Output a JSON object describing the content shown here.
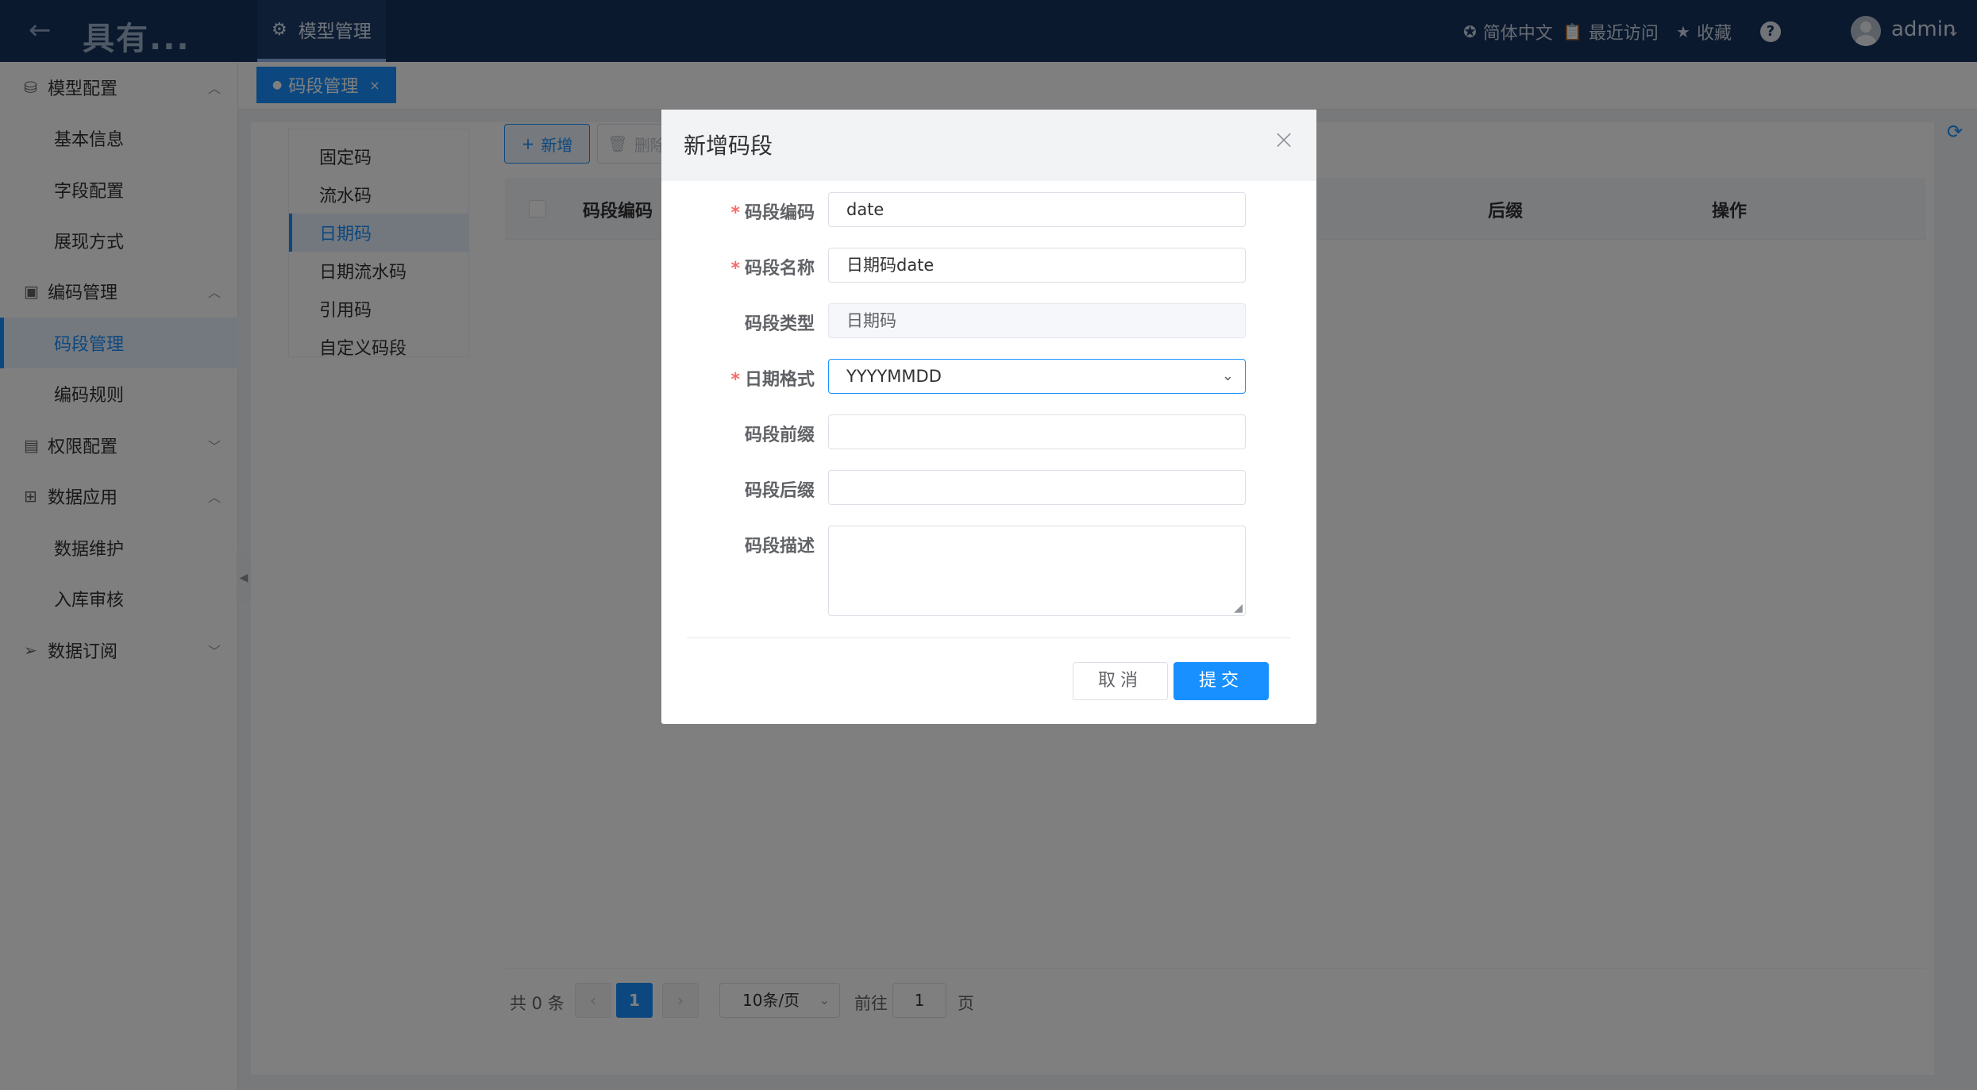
{
  "header": {
    "title": "具有...",
    "active_module": "模型管理",
    "language": "简体中文",
    "recent": "最近访问",
    "favorites": "收藏",
    "help": "?",
    "user": "admin"
  },
  "sidebar": {
    "groups": [
      {
        "label": "模型配置",
        "items": [
          "基本信息",
          "字段配置",
          "展现方式"
        ]
      },
      {
        "label": "编码管理",
        "items": [
          "码段管理",
          "编码规则"
        ]
      },
      {
        "label": "权限配置",
        "items": []
      },
      {
        "label": "数据应用",
        "items": [
          "数据维护",
          "入库审核"
        ]
      },
      {
        "label": "数据订阅",
        "items": []
      }
    ],
    "active_item": "码段管理"
  },
  "page_tab": {
    "label": "码段管理",
    "close": "×"
  },
  "segment_types": [
    "固定码",
    "流水码",
    "日期码",
    "日期流水码",
    "引用码",
    "自定义码段"
  ],
  "segment_types_active": "日期码",
  "toolbar": {
    "add": "新增",
    "delete": "删除"
  },
  "table": {
    "columns": [
      "码段编码",
      "后缀",
      "操作"
    ]
  },
  "pagination": {
    "total": "共 0 条",
    "current_page": "1",
    "page_size": "10条/页",
    "goto_label": "前往",
    "goto_value": "1",
    "page_suffix": "页"
  },
  "dialog": {
    "title": "新增码段",
    "fields": [
      {
        "label": "码段编码",
        "required": true,
        "value": "date"
      },
      {
        "label": "码段名称",
        "required": true,
        "value": "日期码date"
      },
      {
        "label": "码段类型",
        "required": false,
        "value": "日期码",
        "disabled": true
      },
      {
        "label": "日期格式",
        "required": true,
        "value": "YYYYMMDD",
        "type": "select"
      },
      {
        "label": "码段前缀",
        "required": false,
        "value": ""
      },
      {
        "label": "码段后缀",
        "required": false,
        "value": ""
      },
      {
        "label": "码段描述",
        "required": false,
        "value": "",
        "type": "textarea"
      }
    ],
    "cancel": "取消",
    "submit": "提交"
  },
  "colors": {
    "header_bg": "#14325c",
    "primary": "#1890ff",
    "required": "#f56c6c"
  }
}
